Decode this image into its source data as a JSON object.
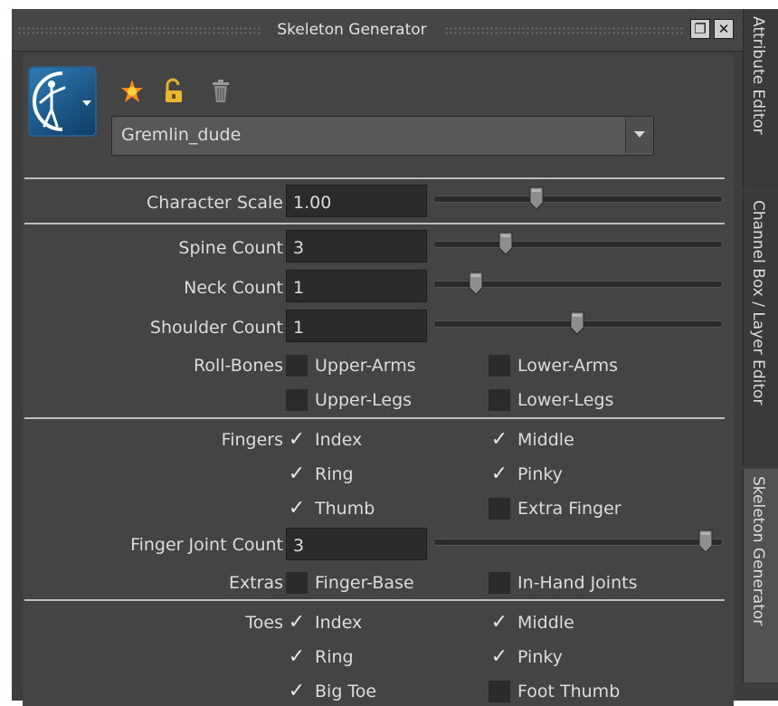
{
  "window": {
    "title": "Skeleton Generator"
  },
  "preset": {
    "name": "Gremlin_dude"
  },
  "side_tabs": [
    "Attribute Editor",
    "Channel Box / Layer Editor",
    "Skeleton Generator"
  ],
  "params": {
    "character_scale": {
      "label": "Character Scale",
      "value": "1.00",
      "slider": 0.35
    },
    "spine_count": {
      "label": "Spine Count",
      "value": "3",
      "slider": 0.24
    },
    "neck_count": {
      "label": "Neck Count",
      "value": "1",
      "slider": 0.13
    },
    "shoulder_count": {
      "label": "Shoulder Count",
      "value": "1",
      "slider": 0.5
    },
    "finger_joint_count": {
      "label": "Finger Joint Count",
      "value": "3",
      "slider": 0.97
    }
  },
  "roll_bones": {
    "label": "Roll-Bones",
    "upper_arms": {
      "label": "Upper-Arms",
      "checked": false
    },
    "lower_arms": {
      "label": "Lower-Arms",
      "checked": false
    },
    "upper_legs": {
      "label": "Upper-Legs",
      "checked": false
    },
    "lower_legs": {
      "label": "Lower-Legs",
      "checked": false
    }
  },
  "fingers": {
    "label": "Fingers",
    "index": {
      "label": "Index",
      "checked": true
    },
    "middle": {
      "label": "Middle",
      "checked": true
    },
    "ring": {
      "label": "Ring",
      "checked": true
    },
    "pinky": {
      "label": "Pinky",
      "checked": true
    },
    "thumb": {
      "label": "Thumb",
      "checked": true
    },
    "extra_finger": {
      "label": "Extra Finger",
      "checked": false
    }
  },
  "extras": {
    "label": "Extras",
    "finger_base": {
      "label": "Finger-Base",
      "checked": false
    },
    "in_hand_joints": {
      "label": "In-Hand Joints",
      "checked": false
    }
  },
  "toes": {
    "label": "Toes",
    "index": {
      "label": "Index",
      "checked": true
    },
    "middle": {
      "label": "Middle",
      "checked": true
    },
    "ring": {
      "label": "Ring",
      "checked": true
    },
    "pinky": {
      "label": "Pinky",
      "checked": true
    },
    "big_toe": {
      "label": "Big Toe",
      "checked": true
    },
    "foot_thumb": {
      "label": "Foot Thumb",
      "checked": false
    }
  },
  "icons": [
    "skeleton-logo-icon",
    "create-star-icon",
    "unlock-icon",
    "trash-icon",
    "float-window-icon",
    "close-icon"
  ]
}
